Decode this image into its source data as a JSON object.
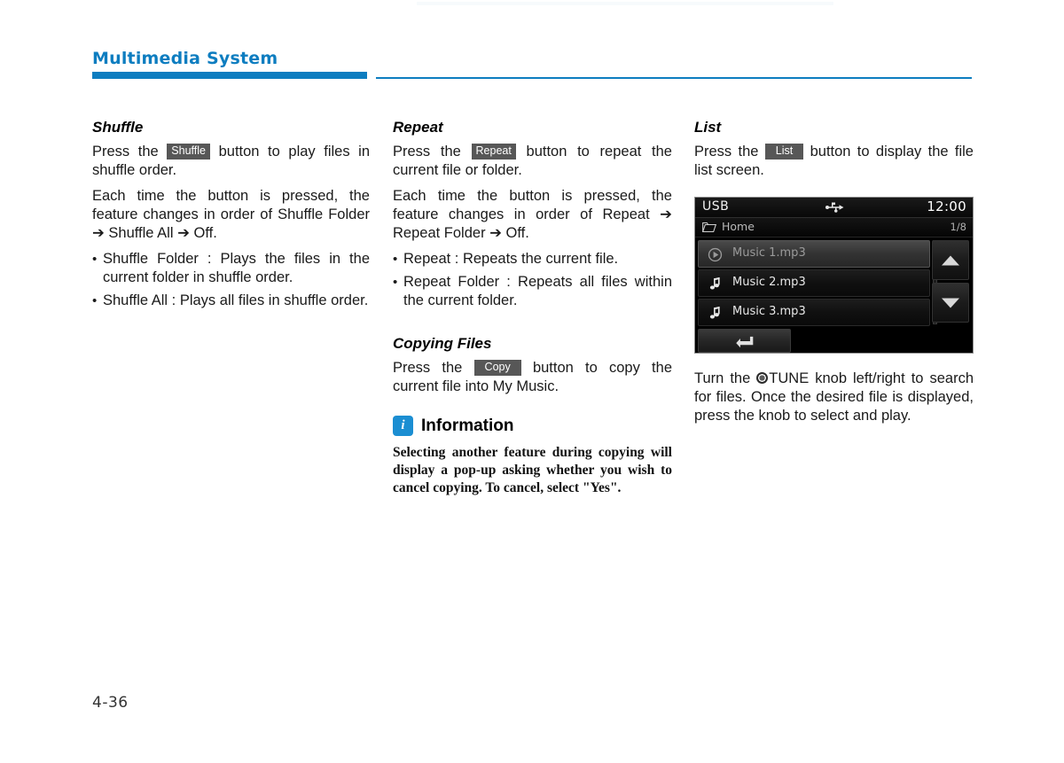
{
  "header": {
    "title": "Multimedia System",
    "accent_color": "#0d7dc0"
  },
  "columns": {
    "shuffle": {
      "heading": "Shuffle",
      "para1_before": "Press the",
      "chip": "Shuffle",
      "para1_after": "button to play files in shuffle order.",
      "para2": "Each time the button is pressed, the feature changes in order of Shuffle Folder ➔ Shuffle All ➔ Off.",
      "bullets": [
        "Shuffle Folder : Plays the files in the current folder in shuffle order.",
        "Shuffle All : Plays all files in shuffle order."
      ]
    },
    "repeat": {
      "heading": "Repeat",
      "para1_before": "Press the",
      "chip": "Repeat",
      "para1_after": "button to repeat the current file or folder.",
      "para2": "Each time the button is pressed, the feature changes in order of Repeat ➔ Repeat Folder ➔ Off.",
      "bullets": [
        "Repeat : Repeats the current file.",
        "Repeat Folder : Repeats all files within the current folder."
      ]
    },
    "copying": {
      "heading": "Copying Files",
      "para1_before": "Press the",
      "chip": "Copy",
      "para1_after": "button to copy the current file into My Music."
    },
    "information": {
      "icon_label": "i",
      "icon_color": "#1b8ed2",
      "title": "Information",
      "body": "Selecting another feature during copying will display a pop-up asking whether you wish to cancel copying. To cancel, select \"Yes\"."
    },
    "list": {
      "heading": "List",
      "para1_before": "Press the",
      "chip": "List",
      "para1_after": "button to display the file list screen.",
      "caption_before": "Turn the",
      "caption_knob": "TUNE",
      "caption_after": "knob left/right to search for files. Once the desired file is displayed, press the knob to select and play."
    }
  },
  "device_screen": {
    "source": "USB",
    "usb_icon": "usb-icon",
    "clock": "12:00",
    "breadcrumb": {
      "folder_icon": "folder-icon",
      "label": "Home",
      "count": "1/8"
    },
    "rows": [
      {
        "label": "Music 1.mp3",
        "icon": "play-circle-icon",
        "selected": true
      },
      {
        "label": "Music 2.mp3",
        "icon": "music-note-icon",
        "selected": false
      },
      {
        "label": "Music 3.mp3",
        "icon": "music-note-icon",
        "selected": false
      }
    ],
    "scroll_up": "scroll-up-arrow",
    "scroll_down": "scroll-down-arrow",
    "back": "back-arrow"
  },
  "folio": "4-36"
}
